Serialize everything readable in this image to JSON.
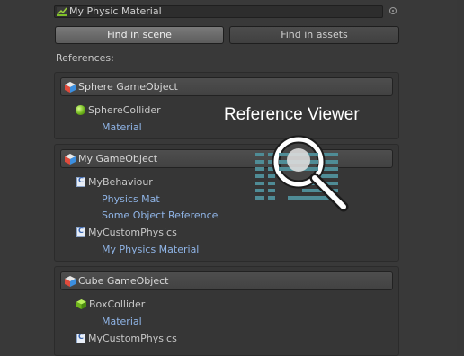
{
  "object_field": {
    "value": "My Physic Material",
    "icon": "physic-material-icon"
  },
  "tabs": {
    "find_in_scene": "Find in scene",
    "find_in_assets": "Find in assets"
  },
  "references_label": "References:",
  "groups": [
    {
      "title": "Sphere GameObject",
      "components": [
        {
          "name": "SphereCollider",
          "icon": "sphere-collider-icon",
          "fields": [
            "Material"
          ]
        }
      ]
    },
    {
      "title": "My GameObject",
      "components": [
        {
          "name": "MyBehaviour",
          "icon": "csharp-script-icon",
          "fields": [
            "Physics Mat",
            "Some Object Reference"
          ]
        },
        {
          "name": "MyCustomPhysics",
          "icon": "csharp-script-icon",
          "fields": [
            "My Physics Material"
          ]
        }
      ]
    },
    {
      "title": "Cube GameObject",
      "components": [
        {
          "name": "BoxCollider",
          "icon": "box-collider-icon",
          "fields": [
            "Material"
          ]
        },
        {
          "name": "MyCustomPhysics",
          "icon": "csharp-script-icon",
          "fields": []
        }
      ]
    }
  ],
  "overlay": {
    "title": "Reference Viewer",
    "icon": "magnifier-list-icon"
  },
  "colors": {
    "background": "#393939",
    "link": "#8fb4e6",
    "accent_cyan": "#4f8c96"
  }
}
